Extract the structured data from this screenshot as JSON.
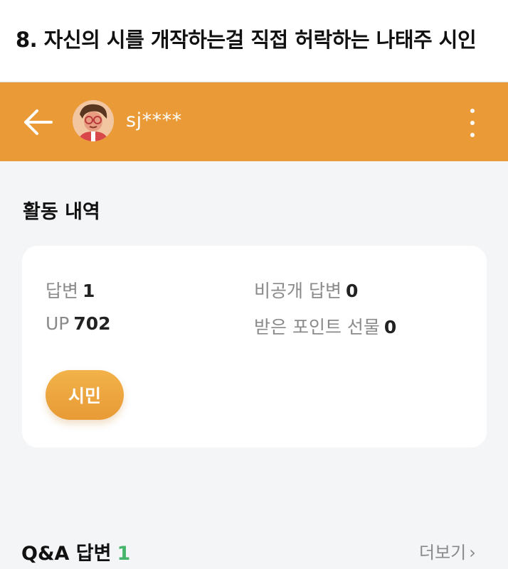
{
  "caption": "8. 자신의 시를 개작하는걸 직접 허락하는 나태주 시인",
  "header": {
    "username": "sj****",
    "back_icon": "arrow-left-icon",
    "more_icon": "more-vertical-icon",
    "accent_color": "#eb9a38"
  },
  "activity": {
    "title": "활동 내역",
    "stats": {
      "answers_label": "답변",
      "answers_value": "1",
      "private_answers_label": "비공개 답변",
      "private_answers_value": "0",
      "up_label": "UP",
      "up_value": "702",
      "points_gift_label": "받은 포인트 선물",
      "points_gift_value": "0"
    },
    "grade_badge": "시민"
  },
  "qa": {
    "title": "Q&A 답변",
    "count": "1",
    "more_label": "더보기",
    "count_color": "#45b56a"
  }
}
